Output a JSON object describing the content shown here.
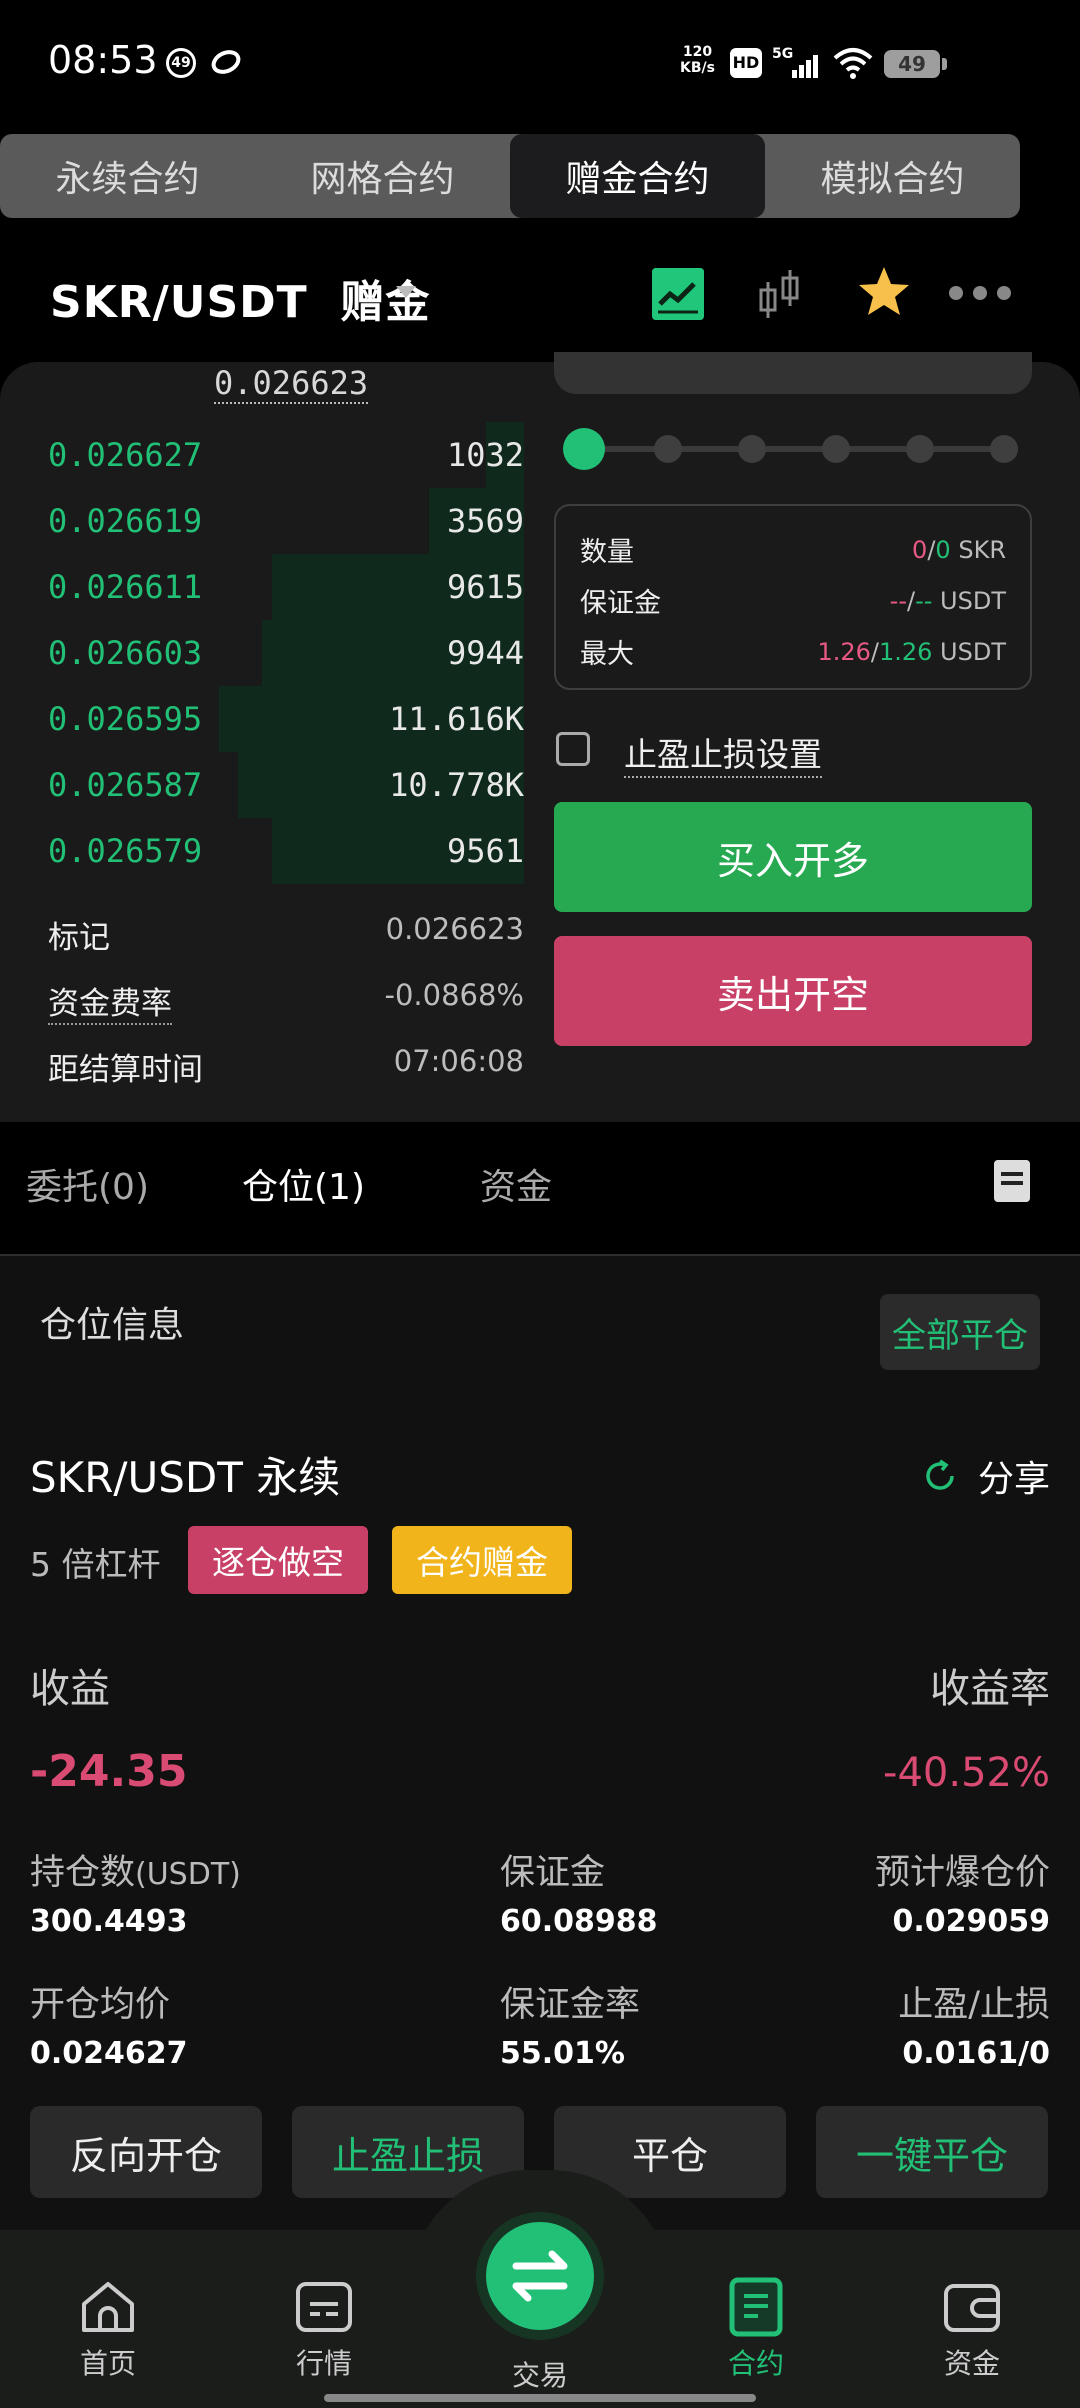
{
  "status_bar": {
    "time": "08:53",
    "badge": "49",
    "net_speed_value": "120",
    "net_speed_unit": "KB/s",
    "hd": "HD",
    "signal": "5G",
    "battery": "49"
  },
  "contract_tabs": [
    "永续合约",
    "网格合约",
    "赠金合约",
    "模拟合约"
  ],
  "header": {
    "pair": "SKR/USDT",
    "mode": "赠金"
  },
  "order_book": {
    "reference_price": "0.026623",
    "rows": [
      {
        "price": "0.026627",
        "qty": "1032",
        "depth": 0.08
      },
      {
        "price": "0.026619",
        "qty": "3569",
        "depth": 0.2
      },
      {
        "price": "0.026611",
        "qty": "9615",
        "depth": 0.53
      },
      {
        "price": "0.026603",
        "qty": "9944",
        "depth": 0.55
      },
      {
        "price": "0.026595",
        "qty": "11.616K",
        "depth": 0.64
      },
      {
        "price": "0.026587",
        "qty": "10.778K",
        "depth": 0.6
      },
      {
        "price": "0.026579",
        "qty": "9561",
        "depth": 0.53
      }
    ],
    "mark_label": "标记",
    "mark_value": "0.026623",
    "funding_label": "资金费率",
    "funding_value": "-0.0868%",
    "settle_label": "距结算时间",
    "settle_value": "07:06:08"
  },
  "order_form": {
    "leverage_steps": 6,
    "leverage_selected": 0,
    "quantity_label": "数量",
    "quantity_a": "0",
    "quantity_sep": "/",
    "quantity_b": "0",
    "quantity_unit": "SKR",
    "margin_label": "保证金",
    "margin_a": "--",
    "margin_sep": "/",
    "margin_b": "--",
    "margin_unit": "USDT",
    "max_label": "最大",
    "max_a": "1.26",
    "max_sep": "/",
    "max_b": "1.26",
    "max_unit": "USDT",
    "tpsl_label": "止盈止损设置",
    "buy_label": "买入开多",
    "sell_label": "卖出开空"
  },
  "position_tabs": {
    "orders": "委托(0)",
    "positions": "仓位(1)",
    "funds": "资金"
  },
  "position": {
    "section_title": "仓位信息",
    "close_all": "全部平仓",
    "pair": "SKR/USDT 永续",
    "share": "分享",
    "leverage": "5 倍杠杆",
    "tag_side": "逐仓做空",
    "tag_bonus": "合约赠金",
    "pnl_label": "收益",
    "roi_label": "收益率",
    "pnl_value": "-24.35",
    "roi_value": "-40.52%",
    "size_label": "持仓数",
    "size_unit": "(USDT)",
    "size_value": "300.4493",
    "margin_label": "保证金",
    "margin_value": "60.08988",
    "liq_label": "预计爆仓价",
    "liq_value": "0.029059",
    "entry_label": "开仓均价",
    "entry_value": "0.024627",
    "margin_ratio_label": "保证金率",
    "margin_ratio_value": "55.01%",
    "tpsl_label": "止盈/止损",
    "tpsl_value": "0.0161/0",
    "actions": [
      "反向开仓",
      "止盈止损",
      "平仓",
      "一键平仓"
    ]
  },
  "bottom_nav": {
    "home": "首页",
    "market": "行情",
    "trade": "交易",
    "contract": "合约",
    "assets": "资金"
  },
  "colors": {
    "green": "#22c076",
    "red": "#c84066",
    "gold": "#f1b41b"
  }
}
